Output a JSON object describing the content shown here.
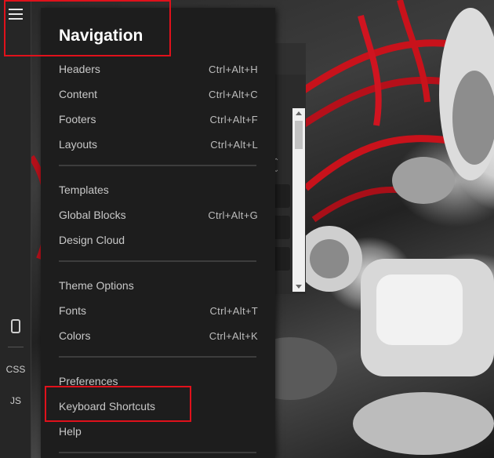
{
  "toolbar": {
    "menu_icon": "hamburger-menu-icon",
    "device_icon": "mobile-device-icon",
    "css_label": "CSS",
    "js_label": "JS"
  },
  "navigation": {
    "title": "Navigation",
    "sections": [
      [
        {
          "label": "Headers",
          "shortcut": "Ctrl+Alt+H"
        },
        {
          "label": "Content",
          "shortcut": "Ctrl+Alt+C"
        },
        {
          "label": "Footers",
          "shortcut": "Ctrl+Alt+F"
        },
        {
          "label": "Layouts",
          "shortcut": "Ctrl+Alt+L"
        }
      ],
      [
        {
          "label": "Templates",
          "shortcut": ""
        },
        {
          "label": "Global Blocks",
          "shortcut": "Ctrl+Alt+G"
        },
        {
          "label": "Design Cloud",
          "shortcut": ""
        }
      ],
      [
        {
          "label": "Theme Options",
          "shortcut": ""
        },
        {
          "label": "Fonts",
          "shortcut": "Ctrl+Alt+T"
        },
        {
          "label": "Colors",
          "shortcut": "Ctrl+Alt+K"
        }
      ],
      [
        {
          "label": "Preferences",
          "shortcut": ""
        },
        {
          "label": "Keyboard Shortcuts",
          "shortcut": ""
        },
        {
          "label": "Help",
          "shortcut": ""
        }
      ]
    ]
  },
  "colors": {
    "highlight": "#e0111b",
    "menu_bg": "#1d1d1d",
    "toolbar_bg": "#262626"
  }
}
